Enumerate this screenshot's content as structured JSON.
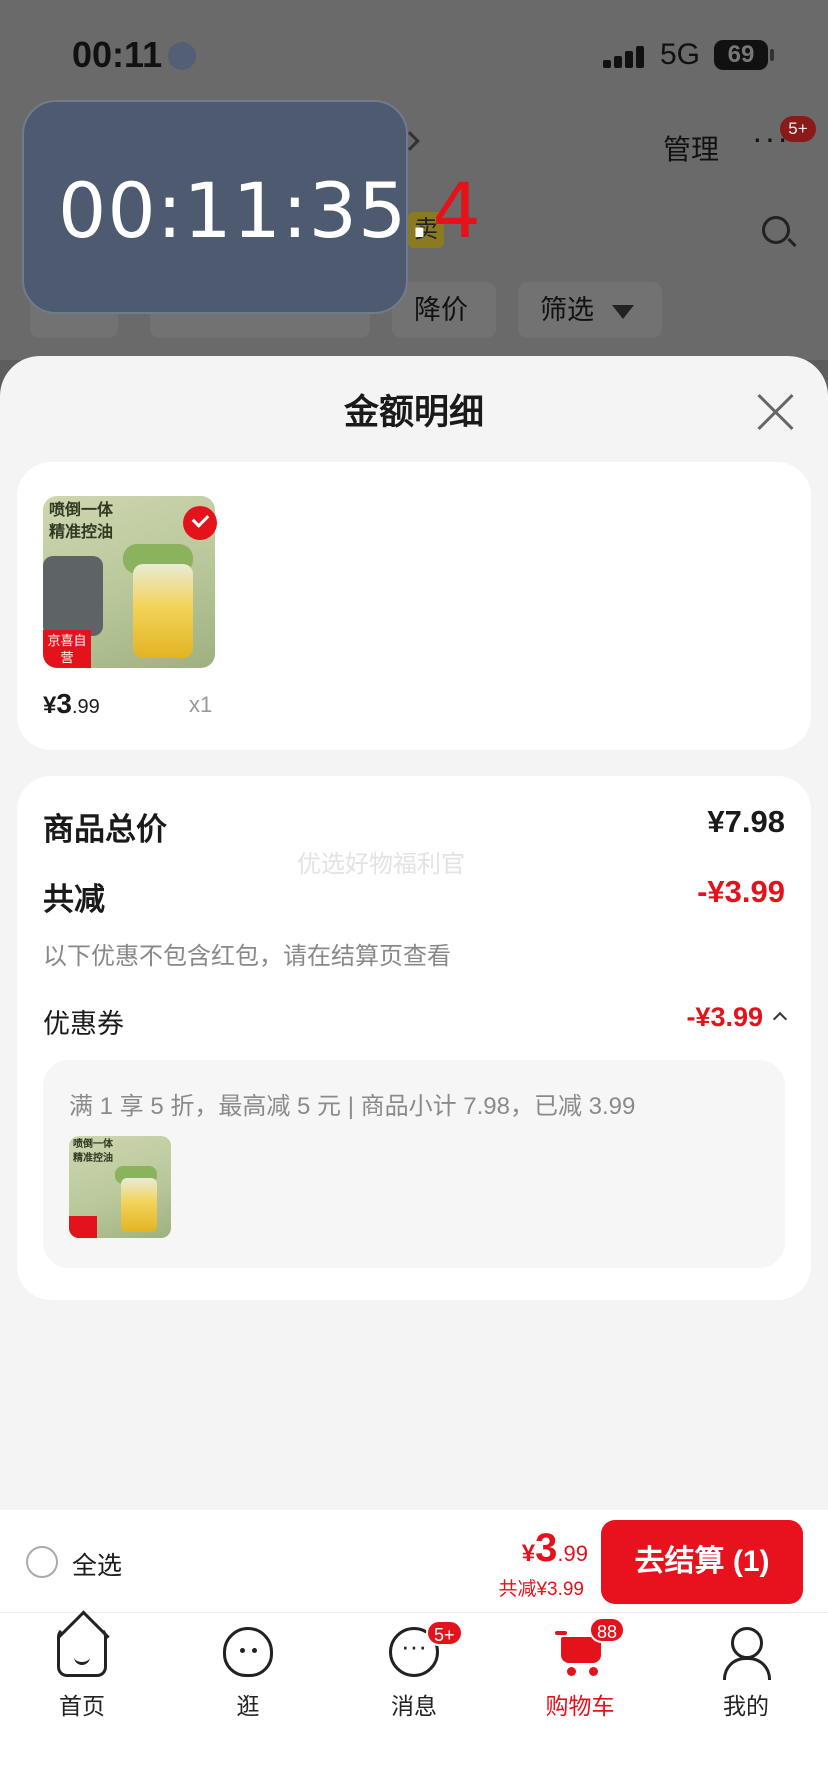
{
  "status_bar": {
    "time": "00:11",
    "network": "5G",
    "battery": "69"
  },
  "background": {
    "manage_label": "管理",
    "more_label": "···",
    "more_badge": "5+",
    "sale_tag": "卖",
    "filter_chips": [
      "降价",
      "筛选"
    ]
  },
  "timer": {
    "main": "00:11:35.",
    "last_digit": "4"
  },
  "sheet": {
    "title": "金额明细",
    "product": {
      "price_symbol": "¥",
      "price_int": "3",
      "price_dec": ".99",
      "quantity": "x1",
      "image_text": "喷倒一体\n精准控油",
      "image_badge": "京喜自营\n包邮"
    },
    "summary": {
      "total_label": "商品总价",
      "total_value": "¥7.98",
      "discount_label": "共减",
      "discount_value": "-¥3.99",
      "discount_note": "以下优惠不包含红包，请在结算页查看",
      "coupon_label": "优惠券",
      "coupon_value": "-¥3.99",
      "coupon_detail": "满 1 享 5 折，最高减 5 元 | 商品小计 7.98，已减 3.99",
      "mini_image_text": "喷倒一体\n精准控油",
      "watermark": "优选好物福利官"
    }
  },
  "checkout": {
    "select_all_label": "全选",
    "total_symbol": "¥",
    "total_int": "3",
    "total_dec": ".99",
    "total_discount": "共减¥3.99",
    "button_label": "去结算 (1)"
  },
  "tabs": [
    {
      "label": "首页",
      "icon": "home-icon"
    },
    {
      "label": "逛",
      "icon": "stroll-icon"
    },
    {
      "label": "消息",
      "icon": "message-icon",
      "badge": "5+"
    },
    {
      "label": "购物车",
      "icon": "cart-icon",
      "badge": "88",
      "active": true
    },
    {
      "label": "我的",
      "icon": "profile-icon"
    }
  ],
  "colors": {
    "accent": "#e3121b",
    "sheet_bg": "#f4f4f4",
    "overlay": "#5d5d5d",
    "timer_bg": "#4d5a70"
  }
}
